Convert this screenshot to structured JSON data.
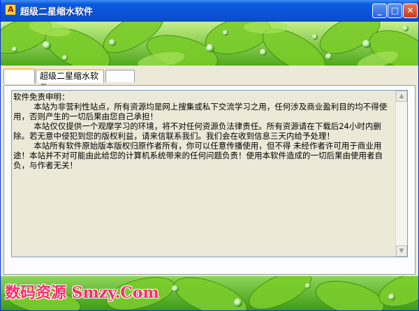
{
  "window": {
    "title": "超级二星缩水软件",
    "app_icon_glyph": "A",
    "minimize_glyph": "_",
    "maximize_glyph": "□",
    "close_glyph": "✕"
  },
  "tabs": [
    {
      "label": ""
    },
    {
      "label": "超级二星缩水软件"
    },
    {
      "label": ""
    }
  ],
  "disclaimer": {
    "text": "软件免责申明：\n        本站为非营利性站点，所有资源均是网上搜集或私下交流学习之用，任何涉及商业盈利目的均不得使用，否则产生的一切后果由您自己承担！\n        本站仅仅提供一个观摩学习的环境，将不对任何资源负法律责任。所有资源请在下载后24小时内删除。若无意中侵犯到您的版权利益，请来信联系我们。我们会在收到信息三天内给予处理！\n        本站所有软件原始版本版权归原作者所有，你可以任意传播使用，但不得 未经作者许可用于商业用途！本站并不对可能由此给您的计算机系统带来的任何问题负责！使用本软件造成的一切后果由使用者自负，与作者无关！"
  },
  "watermark": {
    "text": "数码资源 Smzy.Com"
  },
  "colors": {
    "titlebar": "#0a55d8",
    "leaf_green": "#6cc21c",
    "sky": "#8fd16a",
    "watermark": "#ff2a6a"
  }
}
